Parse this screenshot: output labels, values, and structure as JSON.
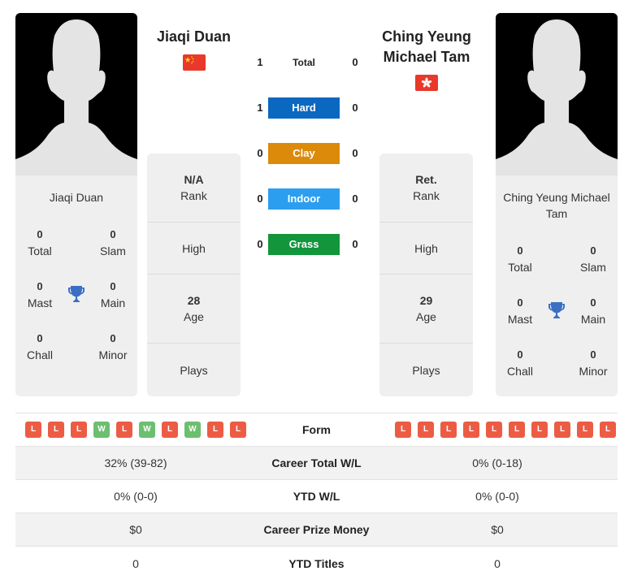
{
  "colors": {
    "hard": "#0a68c0",
    "clay": "#dc8a0a",
    "indoor": "#2b9ef0",
    "grass": "#12953b",
    "loss": "#ec5c45",
    "win": "#6cbf6f",
    "trophy": "#3b6fc4"
  },
  "player1": {
    "name": "Jiaqi Duan",
    "card_name": "Jiaqi Duan",
    "flag": "china-flag",
    "titles": {
      "total": {
        "value": "0",
        "label": "Total"
      },
      "slam": {
        "value": "0",
        "label": "Slam"
      },
      "mast": {
        "value": "0",
        "label": "Mast"
      },
      "main": {
        "value": "0",
        "label": "Main"
      },
      "chall": {
        "value": "0",
        "label": "Chall"
      },
      "minor": {
        "value": "0",
        "label": "Minor"
      }
    },
    "info": {
      "rank_value": "N/A",
      "rank_label": "Rank",
      "high_label": "High",
      "age_value": "28",
      "age_label": "Age",
      "plays_label": "Plays"
    },
    "form": [
      "L",
      "L",
      "L",
      "W",
      "L",
      "W",
      "L",
      "W",
      "L",
      "L"
    ]
  },
  "player2": {
    "name": "Ching Yeung Michael Tam",
    "card_name": "Ching Yeung Michael Tam",
    "flag": "hong-kong-flag",
    "titles": {
      "total": {
        "value": "0",
        "label": "Total"
      },
      "slam": {
        "value": "0",
        "label": "Slam"
      },
      "mast": {
        "value": "0",
        "label": "Mast"
      },
      "main": {
        "value": "0",
        "label": "Main"
      },
      "chall": {
        "value": "0",
        "label": "Chall"
      },
      "minor": {
        "value": "0",
        "label": "Minor"
      }
    },
    "info": {
      "rank_value": "Ret.",
      "rank_label": "Rank",
      "high_label": "High",
      "age_value": "29",
      "age_label": "Age",
      "plays_label": "Plays"
    },
    "form": [
      "L",
      "L",
      "L",
      "L",
      "L",
      "L",
      "L",
      "L",
      "L",
      "L"
    ]
  },
  "h2h": [
    {
      "label": "Total",
      "p1": "1",
      "p2": "0",
      "key": "total"
    },
    {
      "label": "Hard",
      "p1": "1",
      "p2": "0",
      "key": "hard"
    },
    {
      "label": "Clay",
      "p1": "0",
      "p2": "0",
      "key": "clay"
    },
    {
      "label": "Indoor",
      "p1": "0",
      "p2": "0",
      "key": "indoor"
    },
    {
      "label": "Grass",
      "p1": "0",
      "p2": "0",
      "key": "grass"
    }
  ],
  "stats": {
    "form_label": "Form",
    "rows": [
      {
        "label": "Career Total W/L",
        "p1": "32% (39-82)",
        "p2": "0% (0-18)"
      },
      {
        "label": "YTD W/L",
        "p1": "0% (0-0)",
        "p2": "0% (0-0)"
      },
      {
        "label": "Career Prize Money",
        "p1": "$0",
        "p2": "$0"
      },
      {
        "label": "YTD Titles",
        "p1": "0",
        "p2": "0"
      }
    ]
  }
}
